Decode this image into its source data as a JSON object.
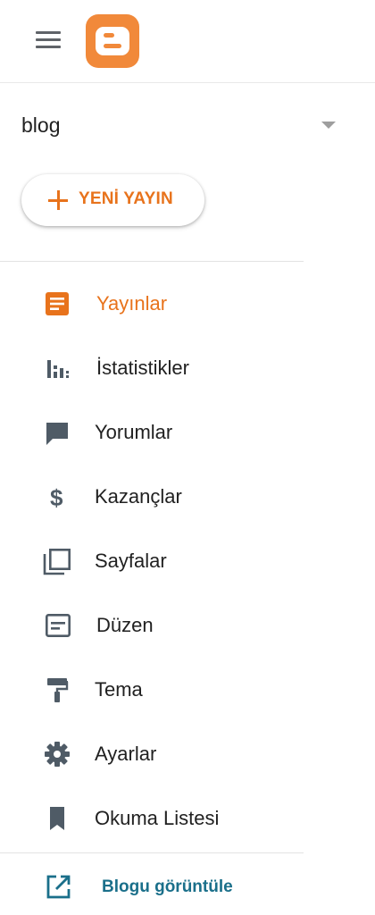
{
  "header": {
    "menu_icon": "hamburger-menu-icon",
    "logo_icon": "blogger-logo-icon",
    "logo_color": "#f1893a"
  },
  "blog_selector": {
    "name": "blog",
    "dropdown_icon": "caret-down-icon"
  },
  "new_post": {
    "label": "YENİ YAYIN",
    "icon": "plus-icon",
    "color": "#e8731c"
  },
  "nav": {
    "items": [
      {
        "label": "Yayınlar",
        "icon": "posts-icon",
        "active": true
      },
      {
        "label": "İstatistikler",
        "icon": "stats-icon",
        "active": false
      },
      {
        "label": "Yorumlar",
        "icon": "comments-icon",
        "active": false
      },
      {
        "label": "Kazançlar",
        "icon": "dollar-icon",
        "active": false
      },
      {
        "label": "Sayfalar",
        "icon": "pages-icon",
        "active": false
      },
      {
        "label": "Düzen",
        "icon": "layout-icon",
        "active": false
      },
      {
        "label": "Tema",
        "icon": "paint-roller-icon",
        "active": false
      },
      {
        "label": "Ayarlar",
        "icon": "gear-icon",
        "active": false
      },
      {
        "label": "Okuma Listesi",
        "icon": "bookmark-icon",
        "active": false
      }
    ]
  },
  "view_blog": {
    "label": "Blogu görüntüle",
    "icon": "open-in-new-icon",
    "color": "#1a6f8a"
  },
  "colors": {
    "accent": "#e8731c",
    "icon_gray": "#4f5b66",
    "link_teal": "#1a6f8a"
  }
}
